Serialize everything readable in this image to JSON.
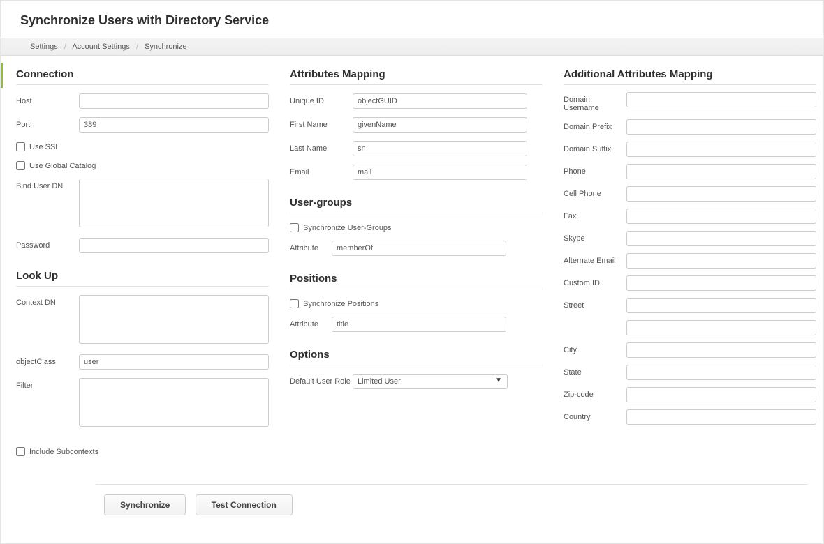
{
  "page_title": "Synchronize Users with Directory Service",
  "breadcrumb": [
    "Settings",
    "Account Settings",
    "Synchronize"
  ],
  "sections": {
    "connection": {
      "title": "Connection",
      "host_label": "Host",
      "host_value": "",
      "port_label": "Port",
      "port_value": "389",
      "use_ssl_label": "Use SSL",
      "use_ssl_checked": false,
      "use_gc_label": "Use Global Catalog",
      "use_gc_checked": false,
      "bind_dn_label": "Bind User DN",
      "bind_dn_value": "",
      "password_label": "Password",
      "password_value": ""
    },
    "lookup": {
      "title": "Look Up",
      "context_dn_label": "Context DN",
      "context_dn_value": "",
      "objectclass_label": "objectClass",
      "objectclass_value": "user",
      "filter_label": "Filter",
      "filter_value": "",
      "include_sub_label": "Include Subcontexts",
      "include_sub_checked": false
    },
    "attr_map": {
      "title": "Attributes Mapping",
      "unique_id_label": "Unique ID",
      "unique_id_value": "objectGUID",
      "first_name_label": "First Name",
      "first_name_value": "givenName",
      "last_name_label": "Last Name",
      "last_name_value": "sn",
      "email_label": "Email",
      "email_value": "mail"
    },
    "user_groups": {
      "title": "User-groups",
      "sync_label": "Synchronize User-Groups",
      "sync_checked": false,
      "attr_label": "Attribute",
      "attr_value": "memberOf"
    },
    "positions": {
      "title": "Positions",
      "sync_label": "Synchronize Positions",
      "sync_checked": false,
      "attr_label": "Attribute",
      "attr_value": "title"
    },
    "options": {
      "title": "Options",
      "default_role_label": "Default User Role",
      "default_role_value": "Limited User"
    },
    "add_attr": {
      "title": "Additional Attributes Mapping",
      "fields": [
        {
          "label": "Domain Username",
          "value": ""
        },
        {
          "label": "Domain Prefix",
          "value": ""
        },
        {
          "label": "Domain Suffix",
          "value": ""
        },
        {
          "label": "Phone",
          "value": ""
        },
        {
          "label": "Cell Phone",
          "value": ""
        },
        {
          "label": "Fax",
          "value": ""
        },
        {
          "label": "Skype",
          "value": ""
        },
        {
          "label": "Alternate Email",
          "value": ""
        },
        {
          "label": "Custom ID",
          "value": ""
        },
        {
          "label": "Street",
          "value": ""
        },
        {
          "label": "",
          "value": ""
        },
        {
          "label": "City",
          "value": ""
        },
        {
          "label": "State",
          "value": ""
        },
        {
          "label": "Zip-code",
          "value": ""
        },
        {
          "label": "Country",
          "value": ""
        }
      ]
    }
  },
  "buttons": {
    "synchronize": "Synchronize",
    "test_connection": "Test Connection"
  }
}
